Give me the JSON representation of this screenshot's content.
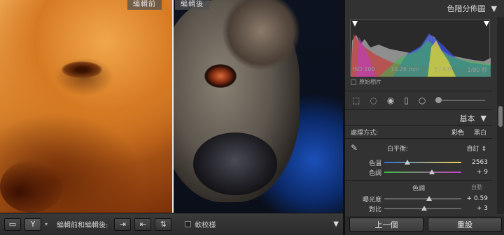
{
  "photo": {
    "before_label": "編輯前",
    "after_label": "編輯後"
  },
  "toolbar": {
    "view_label": "編輯前和編輯後:",
    "proof_label": "軟校樣"
  },
  "panel": {
    "histogram_title": "色階分佈圖",
    "histogram_info": {
      "iso": "ISO 100",
      "focal": "10.28 mm",
      "aperture": "ƒ / 4.0",
      "shutter": "1/80 秒"
    },
    "original_photo": "原始相片",
    "basic_title": "基本",
    "treatment_label": "處理方式:",
    "treatment_color": "彩色",
    "treatment_bw": "黑白",
    "wb_label": "白平衡:",
    "wb_value": "自訂 ⇕",
    "temp_label": "色溫",
    "temp_value": "2563",
    "temp_pos": 0.3,
    "tint_label": "色調",
    "tint_value": "+ 9",
    "tint_pos": 0.62,
    "tone_header": "色調",
    "auto_label": "自動",
    "exposure_label": "曝光度",
    "exposure_value": "+ 0.59",
    "exposure_pos": 0.58,
    "contrast_label": "對比",
    "contrast_value": "+ 3",
    "contrast_pos": 0.52,
    "prev_button": "上一個",
    "reset_button": "重設"
  },
  "colors": {
    "temp_gradient": [
      "#2f6fd6",
      "#f2d24a"
    ],
    "tint_gradient": [
      "#3fbf3f",
      "#c83fc8"
    ],
    "divider": "#e9e9e9"
  }
}
